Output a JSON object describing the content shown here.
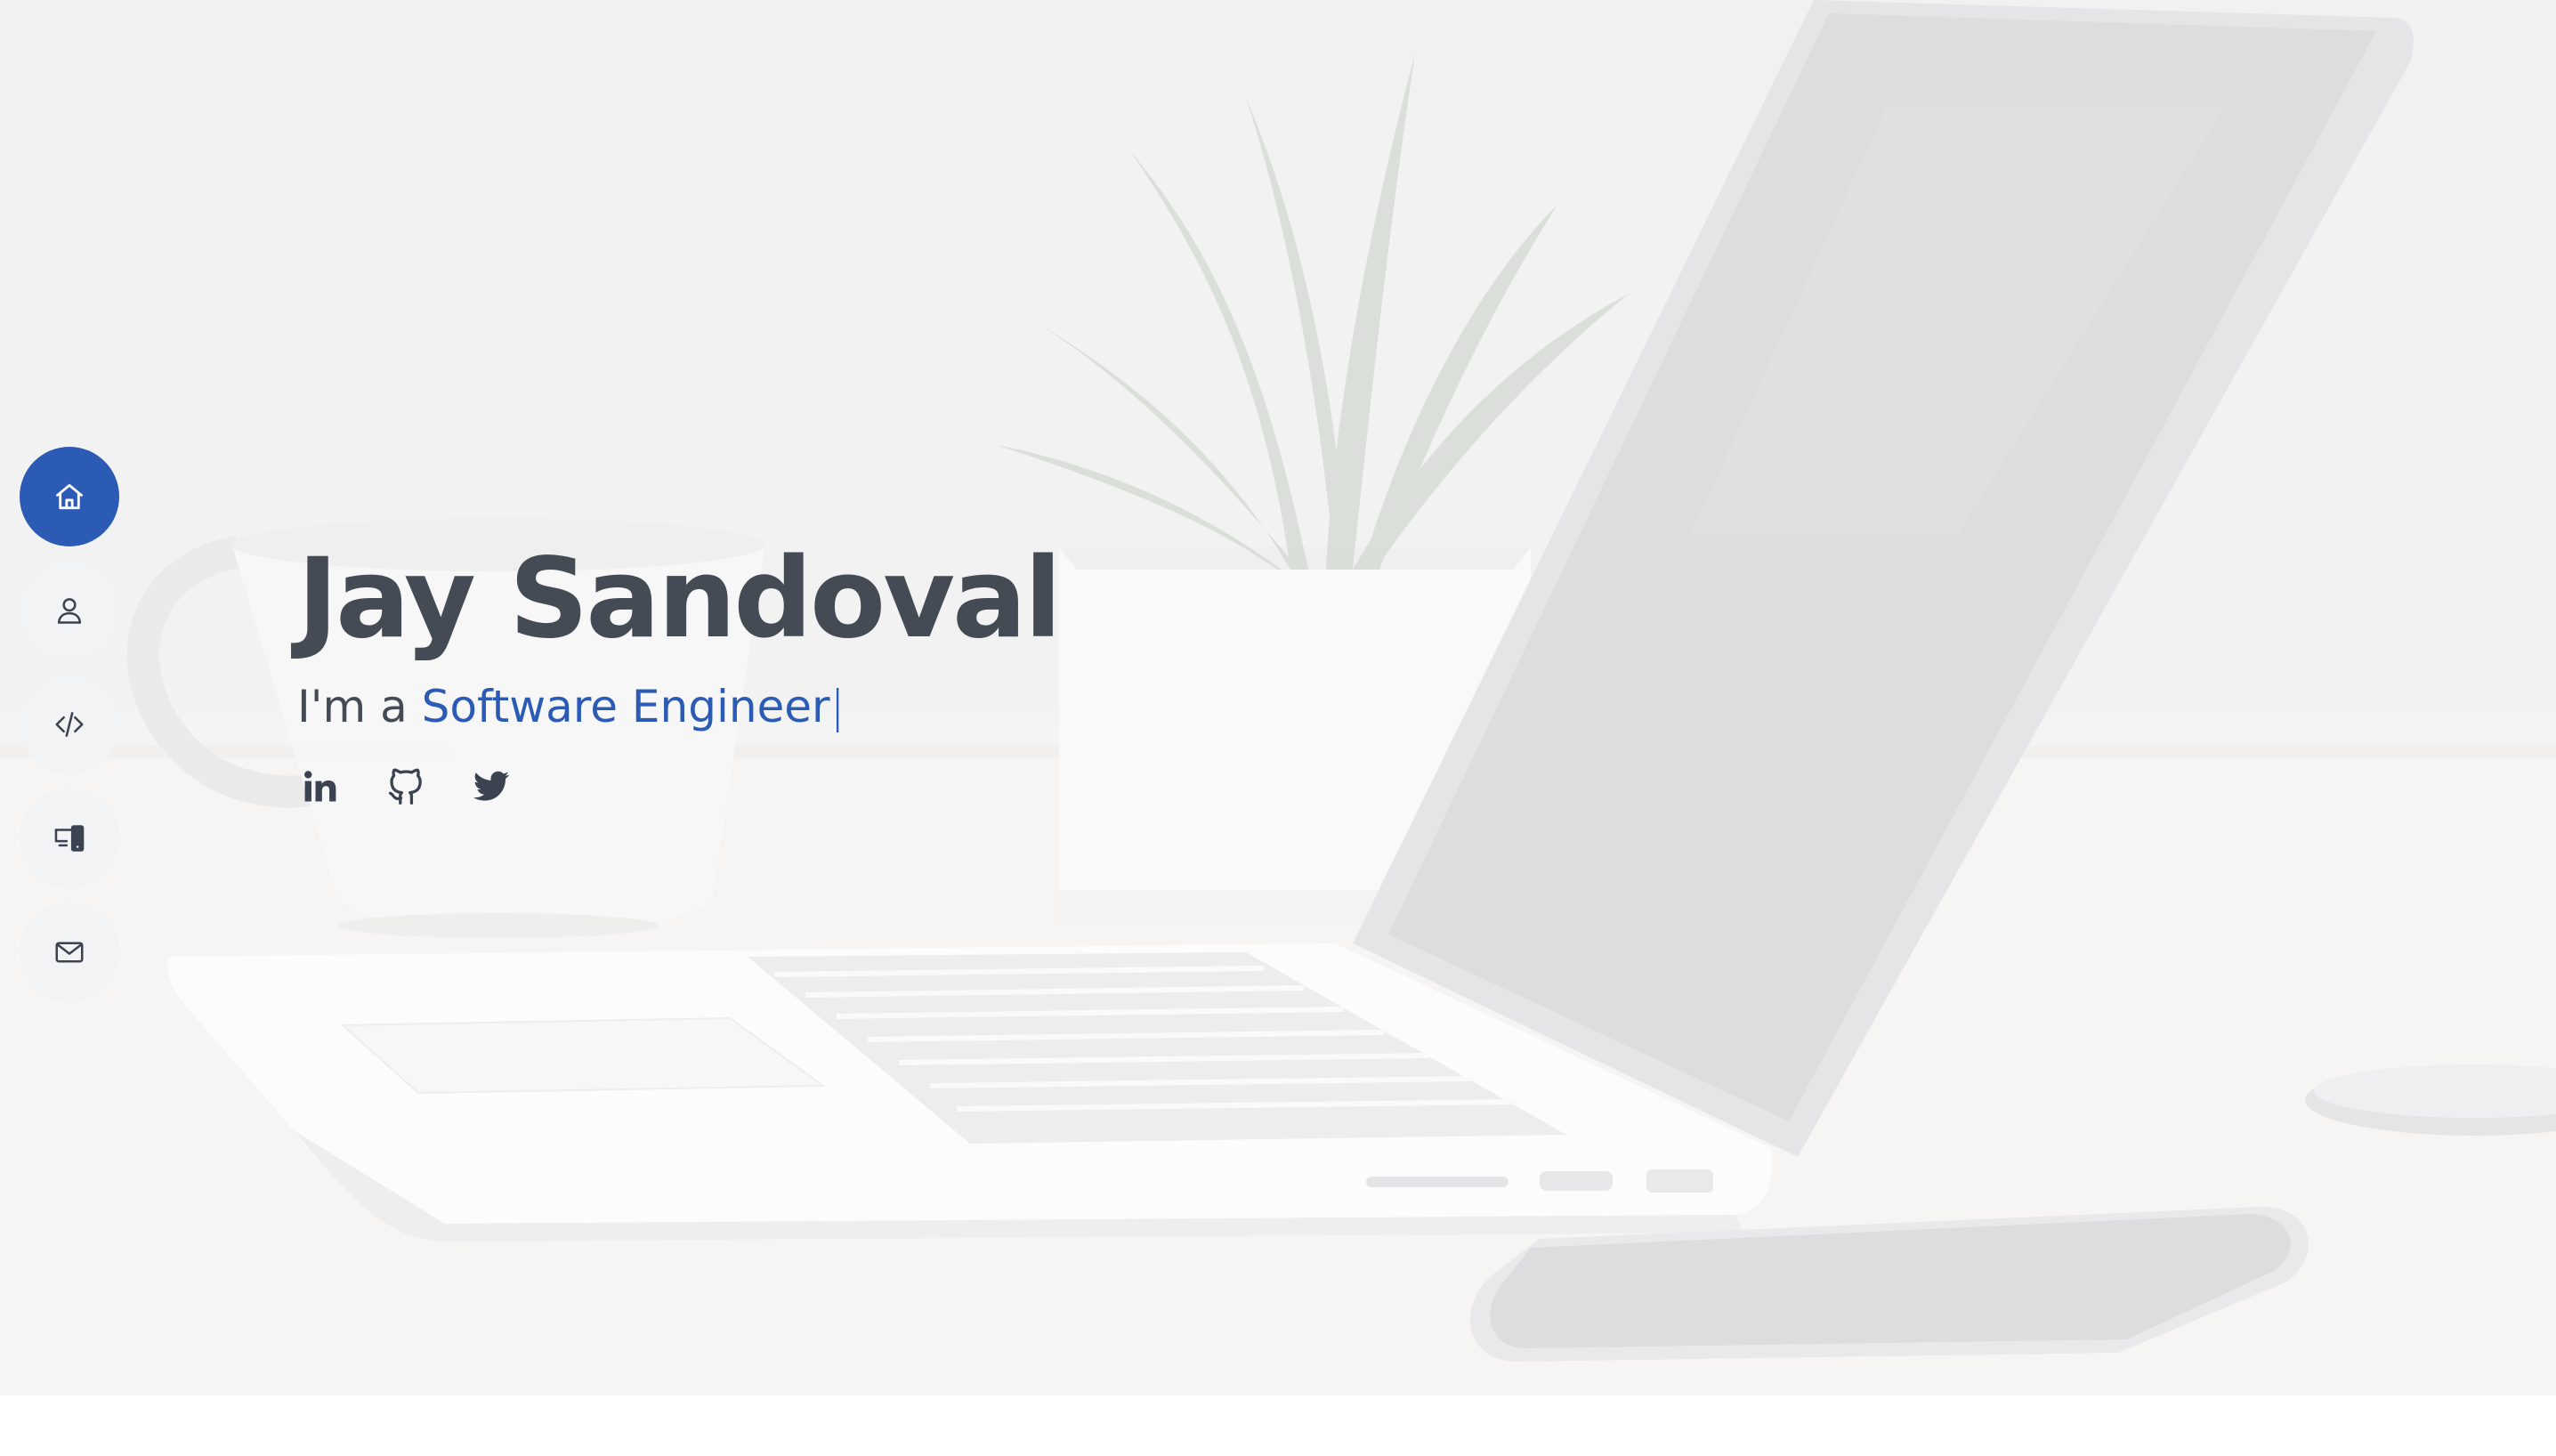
{
  "hero": {
    "name": "Jay Sandoval",
    "tagline_prefix": "I'm a ",
    "role": "Software Engineer",
    "cursor": "|",
    "background_image": "desk-workspace-photo"
  },
  "nav": {
    "items": [
      {
        "id": "home",
        "icon": "home-icon",
        "active": true
      },
      {
        "id": "about",
        "icon": "user-icon",
        "active": false
      },
      {
        "id": "skills",
        "icon": "code-icon",
        "active": false
      },
      {
        "id": "portfolio",
        "icon": "devices-icon",
        "active": false
      },
      {
        "id": "contact",
        "icon": "mail-icon",
        "active": false
      }
    ]
  },
  "social": {
    "links": [
      {
        "id": "linkedin",
        "icon": "linkedin-icon"
      },
      {
        "id": "github",
        "icon": "github-icon"
      },
      {
        "id": "twitter",
        "icon": "twitter-icon"
      }
    ]
  },
  "colors": {
    "accent": "#2c5bb5",
    "text": "#444b55",
    "nav_bg": "#f2f3f5",
    "nav_icon": "#3b4250"
  }
}
